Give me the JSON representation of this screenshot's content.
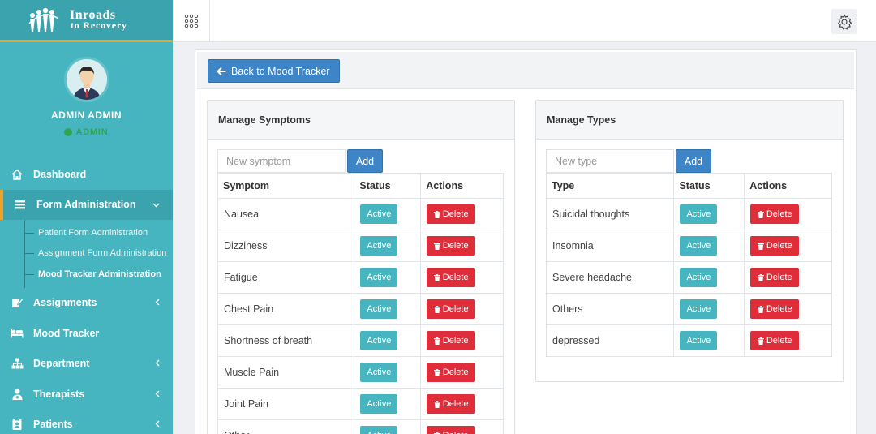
{
  "brand": {
    "line1": "Inroads",
    "line2": "to Recovery"
  },
  "profile": {
    "name": "ADMIN ADMIN",
    "role": "ADMIN"
  },
  "nav": {
    "dashboard": "Dashboard",
    "form_admin": "Form Administration",
    "form_admin_sub": [
      "Patient Form Administration",
      "Assignment Form Administration",
      "Mood Tracker Administration"
    ],
    "assignments": "Assignments",
    "mood_tracker": "Mood Tracker",
    "department": "Department",
    "therapists": "Therapists",
    "patients": "Patients"
  },
  "back_button": "Back to Mood Tracker",
  "symptoms": {
    "title": "Manage Symptoms",
    "placeholder": "New symptom",
    "add_label": "Add",
    "headers": [
      "Symptom",
      "Status",
      "Actions"
    ],
    "rows": [
      {
        "name": "Nausea",
        "status": "Active",
        "action": "Delete"
      },
      {
        "name": "Dizziness",
        "status": "Active",
        "action": "Delete"
      },
      {
        "name": "Fatigue",
        "status": "Active",
        "action": "Delete"
      },
      {
        "name": "Chest Pain",
        "status": "Active",
        "action": "Delete"
      },
      {
        "name": "Shortness of breath",
        "status": "Active",
        "action": "Delete"
      },
      {
        "name": "Muscle Pain",
        "status": "Active",
        "action": "Delete"
      },
      {
        "name": "Joint Pain",
        "status": "Active",
        "action": "Delete"
      },
      {
        "name": "Other",
        "status": "Active",
        "action": "Delete"
      }
    ]
  },
  "types": {
    "title": "Manage Types",
    "placeholder": "New type",
    "add_label": "Add",
    "headers": [
      "Type",
      "Status",
      "Actions"
    ],
    "rows": [
      {
        "name": "Suicidal thoughts",
        "status": "Active",
        "action": "Delete"
      },
      {
        "name": "Insomnia",
        "status": "Active",
        "action": "Delete"
      },
      {
        "name": "Severe headache",
        "status": "Active",
        "action": "Delete"
      },
      {
        "name": "Others",
        "status": "Active",
        "action": "Delete"
      },
      {
        "name": "depressed",
        "status": "Active",
        "action": "Delete"
      }
    ]
  }
}
